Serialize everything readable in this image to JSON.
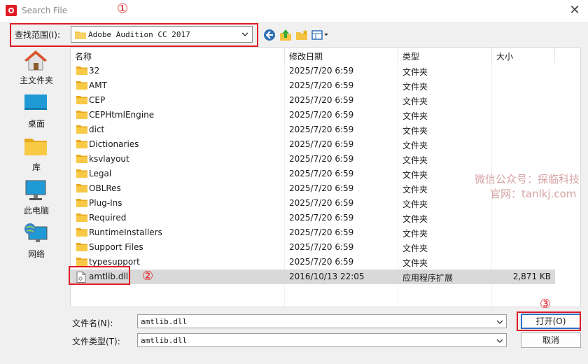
{
  "window": {
    "title": "Search File",
    "close_glyph": "✕"
  },
  "lookin": {
    "label": "查找范围(I):",
    "value": "Adobe Audition CC 2017"
  },
  "toolbar": {
    "icons": [
      "back-icon",
      "up-folder-icon",
      "new-folder-icon",
      "view-menu-icon"
    ]
  },
  "places": [
    {
      "label": "主文件夹",
      "icon": "home-icon"
    },
    {
      "label": "桌面",
      "icon": "desktop-icon"
    },
    {
      "label": "库",
      "icon": "library-folder-icon"
    },
    {
      "label": "此电脑",
      "icon": "computer-icon"
    },
    {
      "label": "网络",
      "icon": "network-icon"
    }
  ],
  "columns": {
    "name": "名称",
    "date": "修改日期",
    "type": "类型",
    "size": "大小"
  },
  "files": [
    {
      "name": "32",
      "date": "2025/7/20 6:59",
      "type": "文件夹",
      "size": ""
    },
    {
      "name": "AMT",
      "date": "2025/7/20 6:59",
      "type": "文件夹",
      "size": ""
    },
    {
      "name": "CEP",
      "date": "2025/7/20 6:59",
      "type": "文件夹",
      "size": ""
    },
    {
      "name": "CEPHtmlEngine",
      "date": "2025/7/20 6:59",
      "type": "文件夹",
      "size": ""
    },
    {
      "name": "dict",
      "date": "2025/7/20 6:59",
      "type": "文件夹",
      "size": ""
    },
    {
      "name": "Dictionaries",
      "date": "2025/7/20 6:59",
      "type": "文件夹",
      "size": ""
    },
    {
      "name": "ksvlayout",
      "date": "2025/7/20 6:59",
      "type": "文件夹",
      "size": ""
    },
    {
      "name": "Legal",
      "date": "2025/7/20 6:59",
      "type": "文件夹",
      "size": ""
    },
    {
      "name": "OBLRes",
      "date": "2025/7/20 6:59",
      "type": "文件夹",
      "size": ""
    },
    {
      "name": "Plug-Ins",
      "date": "2025/7/20 6:59",
      "type": "文件夹",
      "size": ""
    },
    {
      "name": "Required",
      "date": "2025/7/20 6:59",
      "type": "文件夹",
      "size": ""
    },
    {
      "name": "RuntimeInstallers",
      "date": "2025/7/20 6:59",
      "type": "文件夹",
      "size": ""
    },
    {
      "name": "Support Files",
      "date": "2025/7/20 6:59",
      "type": "文件夹",
      "size": ""
    },
    {
      "name": "typesupport",
      "date": "2025/7/20 6:59",
      "type": "文件夹",
      "size": ""
    },
    {
      "name": "amtlib.dll",
      "date": "2016/10/13 22:05",
      "type": "应用程序扩展",
      "size": "2,871 KB",
      "selected": true
    }
  ],
  "filename": {
    "label": "文件名(N):",
    "value": "amtlib.dll"
  },
  "filetype": {
    "label": "文件类型(T):",
    "value": "amtlib.dll"
  },
  "buttons": {
    "open": "打开(O)",
    "cancel": "取消"
  },
  "annotations": {
    "one": "①",
    "two": "②",
    "three": "③"
  },
  "watermark": {
    "line1": "微信公众号：探临科技",
    "line2": "官网：tanlkj.com"
  },
  "colors": {
    "annotation_red": "#e01b24",
    "folder_yellow": "#f5c342",
    "selection": "#d9d9d9"
  }
}
